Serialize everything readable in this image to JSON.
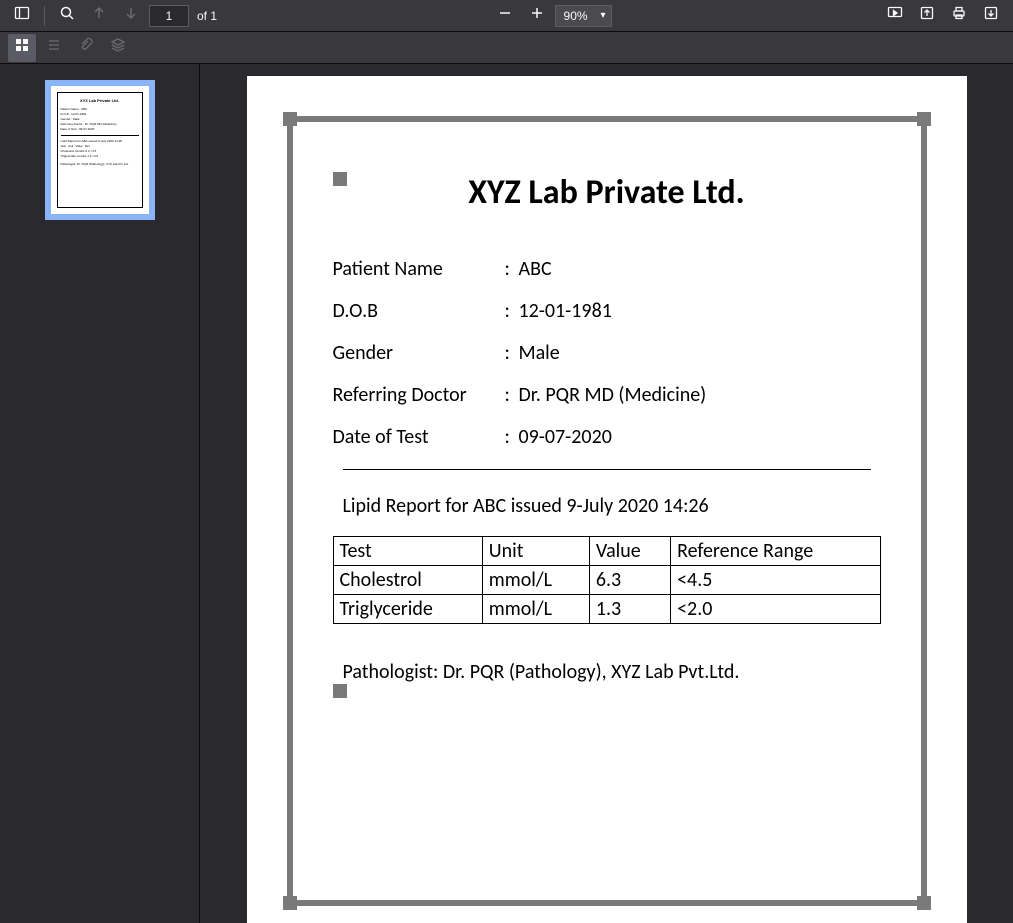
{
  "toolbar": {
    "page_current": "1",
    "page_total": "of 1",
    "zoom": "90%"
  },
  "doc": {
    "title": "XYZ Lab Private Ltd.",
    "fields": [
      {
        "label": "Patient Name",
        "value": "ABC"
      },
      {
        "label": "D.O.B",
        "value": "12-01-1981"
      },
      {
        "label": "Gender",
        "value": "Male"
      },
      {
        "label": "Referring Doctor",
        "value": "Dr. PQR MD (Medicine)"
      },
      {
        "label": "Date of Test",
        "value": "09-07-2020"
      }
    ],
    "report_title": "Lipid Report for ABC issued 9-July 2020 14:26",
    "table": {
      "headers": [
        "Test",
        "Unit",
        "Value",
        "Reference Range"
      ],
      "rows": [
        [
          "Cholestrol",
          "mmol/L",
          "6.3",
          "<4.5"
        ],
        [
          "Triglyceride",
          "mmol/L",
          "1.3",
          "<2.0"
        ]
      ]
    },
    "pathologist": "Pathologist: Dr. PQR (Pathology), XYZ Lab Pvt.Ltd."
  }
}
